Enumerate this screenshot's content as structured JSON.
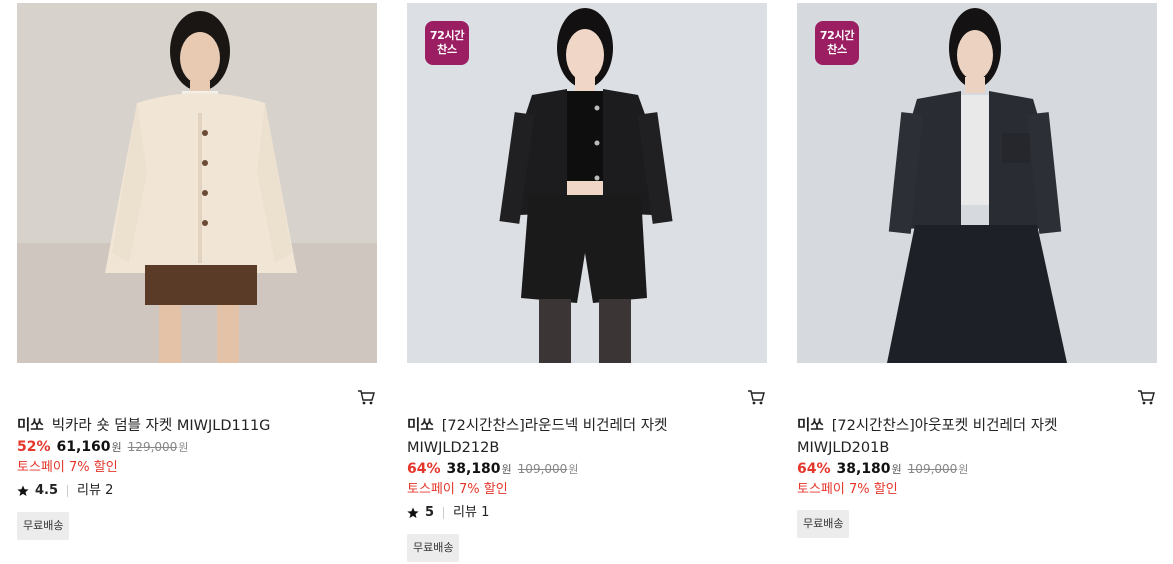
{
  "colors": {
    "discount": "#e5362b",
    "badge": "#9b1d62"
  },
  "products": [
    {
      "brand": "미쏘",
      "title": "빅카라 숏 덤블 자켓 MIWJLD111G",
      "discount": "52%",
      "price": "61,160",
      "currency": "원",
      "original_price": "129,000",
      "toss_offer": "토스페이 7% 할인",
      "rating": "4.5",
      "reviews": "리뷰 2",
      "shipping": "무료배송",
      "badge": null
    },
    {
      "brand": "미쏘",
      "title": "[72시간찬스]라운드넥 비건레더 자켓 MIWJLD212B",
      "discount": "64%",
      "price": "38,180",
      "currency": "원",
      "original_price": "109,000",
      "toss_offer": "토스페이 7% 할인",
      "rating": "5",
      "reviews": "리뷰 1",
      "shipping": "무료배송",
      "badge": {
        "line1": "72시간",
        "line2": "찬스"
      }
    },
    {
      "brand": "미쏘",
      "title": "[72시간찬스]아웃포켓 비건레더 자켓 MIWJLD201B",
      "discount": "64%",
      "price": "38,180",
      "currency": "원",
      "original_price": "109,000",
      "toss_offer": "토스페이 7% 할인",
      "rating": null,
      "reviews": null,
      "shipping": "무료배송",
      "badge": {
        "line1": "72시간",
        "line2": "찬스"
      }
    }
  ],
  "icons": {
    "cart": "cart-icon",
    "star": "star-icon"
  }
}
